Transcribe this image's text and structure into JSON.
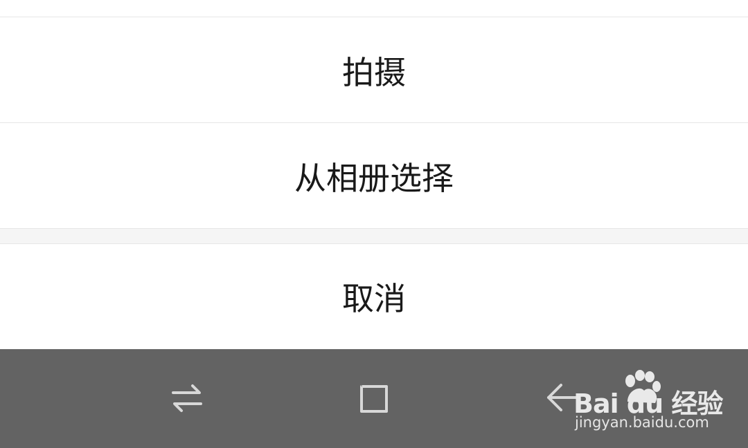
{
  "action_sheet": {
    "take_photo_label": "拍摄",
    "choose_album_label": "从相册选择",
    "cancel_label": "取消"
  },
  "nav_bar": {
    "recents_icon": "recents-switch-icon",
    "home_icon": "home-square-icon",
    "back_icon": "back-arrow-icon"
  },
  "watermark": {
    "logo_text": "Bai du 经验",
    "url": "jingyan.baidu.com"
  },
  "colors": {
    "sheet_bg": "#ffffff",
    "separator": "#e6e6e6",
    "gap_bg": "#f5f5f5",
    "text": "#191919",
    "nav_bg": "#636363",
    "nav_icon": "#d8d8d8"
  }
}
